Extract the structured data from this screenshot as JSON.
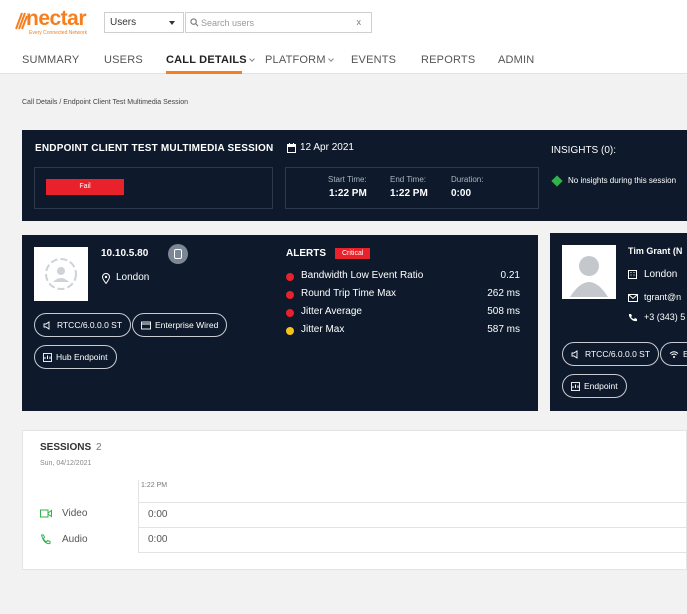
{
  "brand": {
    "name": "nectar",
    "tagline": "Every Connected Network"
  },
  "user_select": {
    "value": "Users"
  },
  "search": {
    "placeholder": "Search users",
    "clear": "x"
  },
  "nav": [
    {
      "label": "SUMMARY"
    },
    {
      "label": "USERS"
    },
    {
      "label": "CALL DETAILS"
    },
    {
      "label": "PLATFORM"
    },
    {
      "label": "EVENTS"
    },
    {
      "label": "REPORTS"
    },
    {
      "label": "ADMIN"
    }
  ],
  "breadcrumb": "Call Details / Endpoint Client Test Multimedia Session",
  "session_header": {
    "title": "ENDPOINT CLIENT TEST MULTIMEDIA SESSION",
    "date": "12 Apr 2021",
    "status": "Fail",
    "start_label": "Start Time:",
    "start_value": "1:22 PM",
    "end_label": "End Time:",
    "end_value": "1:22 PM",
    "duration_label": "Duration:",
    "duration_value": "0:00"
  },
  "insights": {
    "title": "INSIGHTS (0):",
    "message": "No insights during this session"
  },
  "endpoint": {
    "ip": "10.10.5.80",
    "location": "London",
    "pills": [
      "RTCC/6.0.0.0 ST",
      "Enterprise Wired",
      "Hub Endpoint"
    ]
  },
  "alerts": {
    "title": "ALERTS",
    "badge": "Critical",
    "items": [
      {
        "name": "Bandwidth Low Event Ratio",
        "value": "0.21",
        "color": "#e8212a"
      },
      {
        "name": "Round Trip Time Max",
        "value": "262 ms",
        "color": "#e8212a"
      },
      {
        "name": "Jitter Average",
        "value": "508 ms",
        "color": "#e8212a"
      },
      {
        "name": "Jitter Max",
        "value": "587 ms",
        "color": "#f6c417"
      }
    ]
  },
  "user_card": {
    "name": "Tim Grant (N",
    "location": "London",
    "email": "tgrant@n",
    "phone": "+3 (343) 5",
    "pills": [
      "RTCC/6.0.0.0 ST",
      "E",
      "Endpoint"
    ]
  },
  "sessions": {
    "title": "SESSIONS",
    "count": "2",
    "date": "Sun, 04/12/2021",
    "time_tick": "1:22 PM",
    "rows": [
      {
        "label": "Video",
        "value": "0:00"
      },
      {
        "label": "Audio",
        "value": "0:00"
      }
    ]
  },
  "colors": {
    "accent": "#f57f20",
    "panel": "#0e1a2b",
    "fail": "#e8212a",
    "insight": "#2fb34a",
    "media": "#2fb34a"
  }
}
